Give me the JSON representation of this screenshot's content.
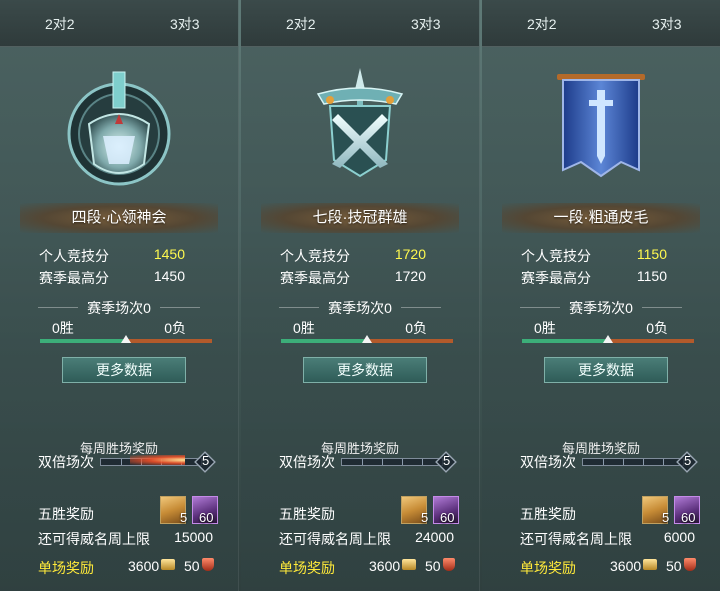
{
  "panels": [
    {
      "tabs": [
        "2对2",
        "3对3"
      ],
      "rank_name": "四段·心领神会",
      "personal_score_label": "个人竞技分",
      "personal_score": "1450",
      "season_best_label": "赛季最高分",
      "season_best": "1450",
      "season_games": "赛季场次0",
      "wins": "0胜",
      "losses": "0负",
      "more_button": "更多数据",
      "weekly_title": "每周胜场奖励",
      "double_label": "双倍场次",
      "double_value": "5",
      "five_win_label": "五胜奖励",
      "item1_qty": "5",
      "item2_qty": "60",
      "cap_label": "还可得威名周上限",
      "cap_value": "15000",
      "single_label": "单场奖励",
      "single_coin": "3600",
      "single_rep": "50",
      "emblem_icon": "rank-emblem-4-icon"
    },
    {
      "tabs": [
        "2对2",
        "3对3"
      ],
      "rank_name": "七段·技冠群雄",
      "personal_score_label": "个人竞技分",
      "personal_score": "1720",
      "season_best_label": "赛季最高分",
      "season_best": "1720",
      "season_games": "赛季场次0",
      "wins": "0胜",
      "losses": "0负",
      "more_button": "更多数据",
      "weekly_title": "每周胜场奖励",
      "double_label": "双倍场次",
      "double_value": "5",
      "five_win_label": "五胜奖励",
      "item1_qty": "5",
      "item2_qty": "60",
      "cap_label": "还可得威名周上限",
      "cap_value": "24000",
      "single_label": "单场奖励",
      "single_coin": "3600",
      "single_rep": "50",
      "emblem_icon": "rank-emblem-7-icon"
    },
    {
      "tabs": [
        "2对2",
        "3对3"
      ],
      "rank_name": "一段·粗通皮毛",
      "personal_score_label": "个人竞技分",
      "personal_score": "1150",
      "season_best_label": "赛季最高分",
      "season_best": "1150",
      "season_games": "赛季场次0",
      "wins": "0胜",
      "losses": "0负",
      "more_button": "更多数据",
      "weekly_title": "每周胜场奖励",
      "double_label": "双倍场次",
      "double_value": "5",
      "five_win_label": "五胜奖励",
      "item1_qty": "5",
      "item2_qty": "60",
      "cap_label": "还可得威名周上限",
      "cap_value": "6000",
      "single_label": "单场奖励",
      "single_coin": "3600",
      "single_rep": "50",
      "emblem_icon": "rank-emblem-1-icon"
    }
  ],
  "colors": {
    "score_highlight": "#fff94f",
    "single_reward_label": "#ffea3a",
    "win_bar": "#3cae79",
    "loss_bar": "#b35a2b",
    "button": "#2f5c58"
  }
}
